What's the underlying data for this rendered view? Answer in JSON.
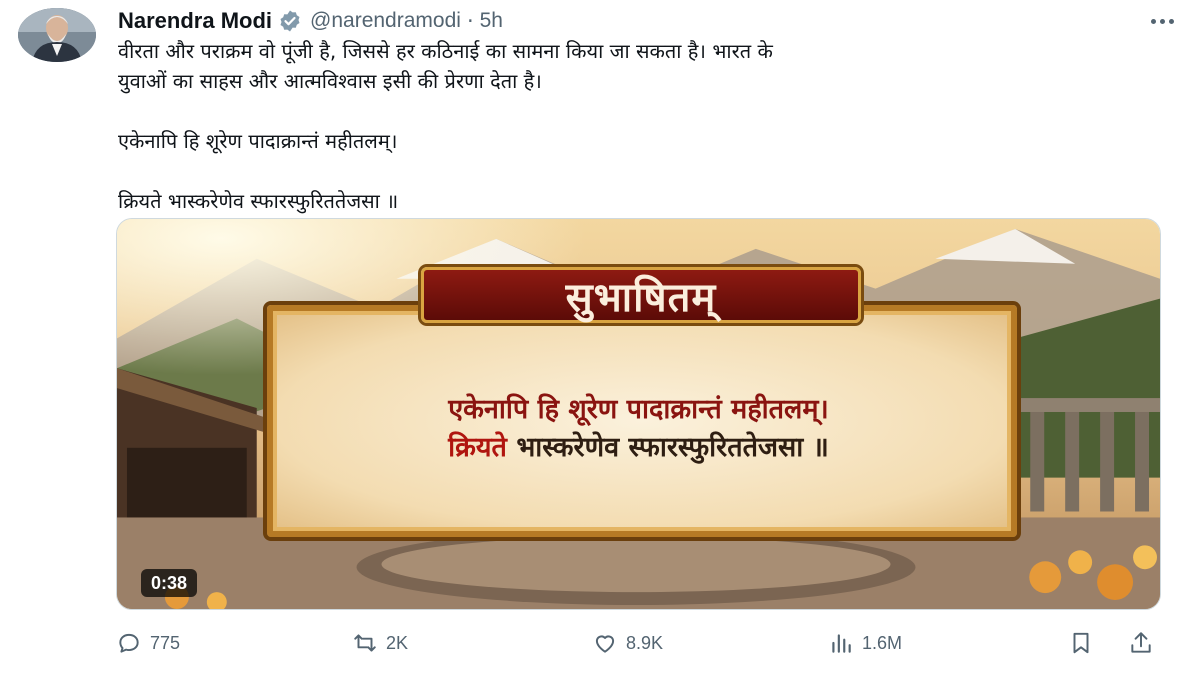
{
  "author": {
    "name": "Narendra Modi",
    "handle": "@narendramodi",
    "separator": "·",
    "time": "5h"
  },
  "tweet": {
    "line1": "वीरता और पराक्रम वो पूंजी है, जिससे हर कठिनाई का सामना किया जा सकता है। भारत के",
    "line2": "युवाओं का साहस और आत्मविश्वास इसी की प्रेरणा देता है।",
    "line3": "एकेनापि हि शूरेण पादाक्रान्तं महीतलम्।",
    "line4": "क्रियते भास्करेणेव स्फारस्फुरिततेजसा ॥"
  },
  "media": {
    "banner_title": "सुभाषितम्",
    "verse1": "एकेनापि हि शूरेण पादाक्रान्तं महीतलम्।",
    "verse2_red": "क्रियते",
    "verse2_rest": " भास्करेणेव स्फारस्फुरिततेजसा ॥",
    "duration": "0:38"
  },
  "actions": {
    "replies": "775",
    "retweets": "2K",
    "likes": "8.9K",
    "views": "1.6M"
  },
  "colors": {
    "text": "#0f1419",
    "muted": "#536471",
    "verified": "#829aab",
    "banner": "#8e1a12",
    "verse_red": "#8a1410"
  },
  "icons": {
    "verified": "verified-badge-icon",
    "more": "more-icon",
    "reply": "reply-icon",
    "retweet": "retweet-icon",
    "like": "heart-icon",
    "views": "views-icon",
    "bookmark": "bookmark-icon",
    "share": "share-icon"
  }
}
